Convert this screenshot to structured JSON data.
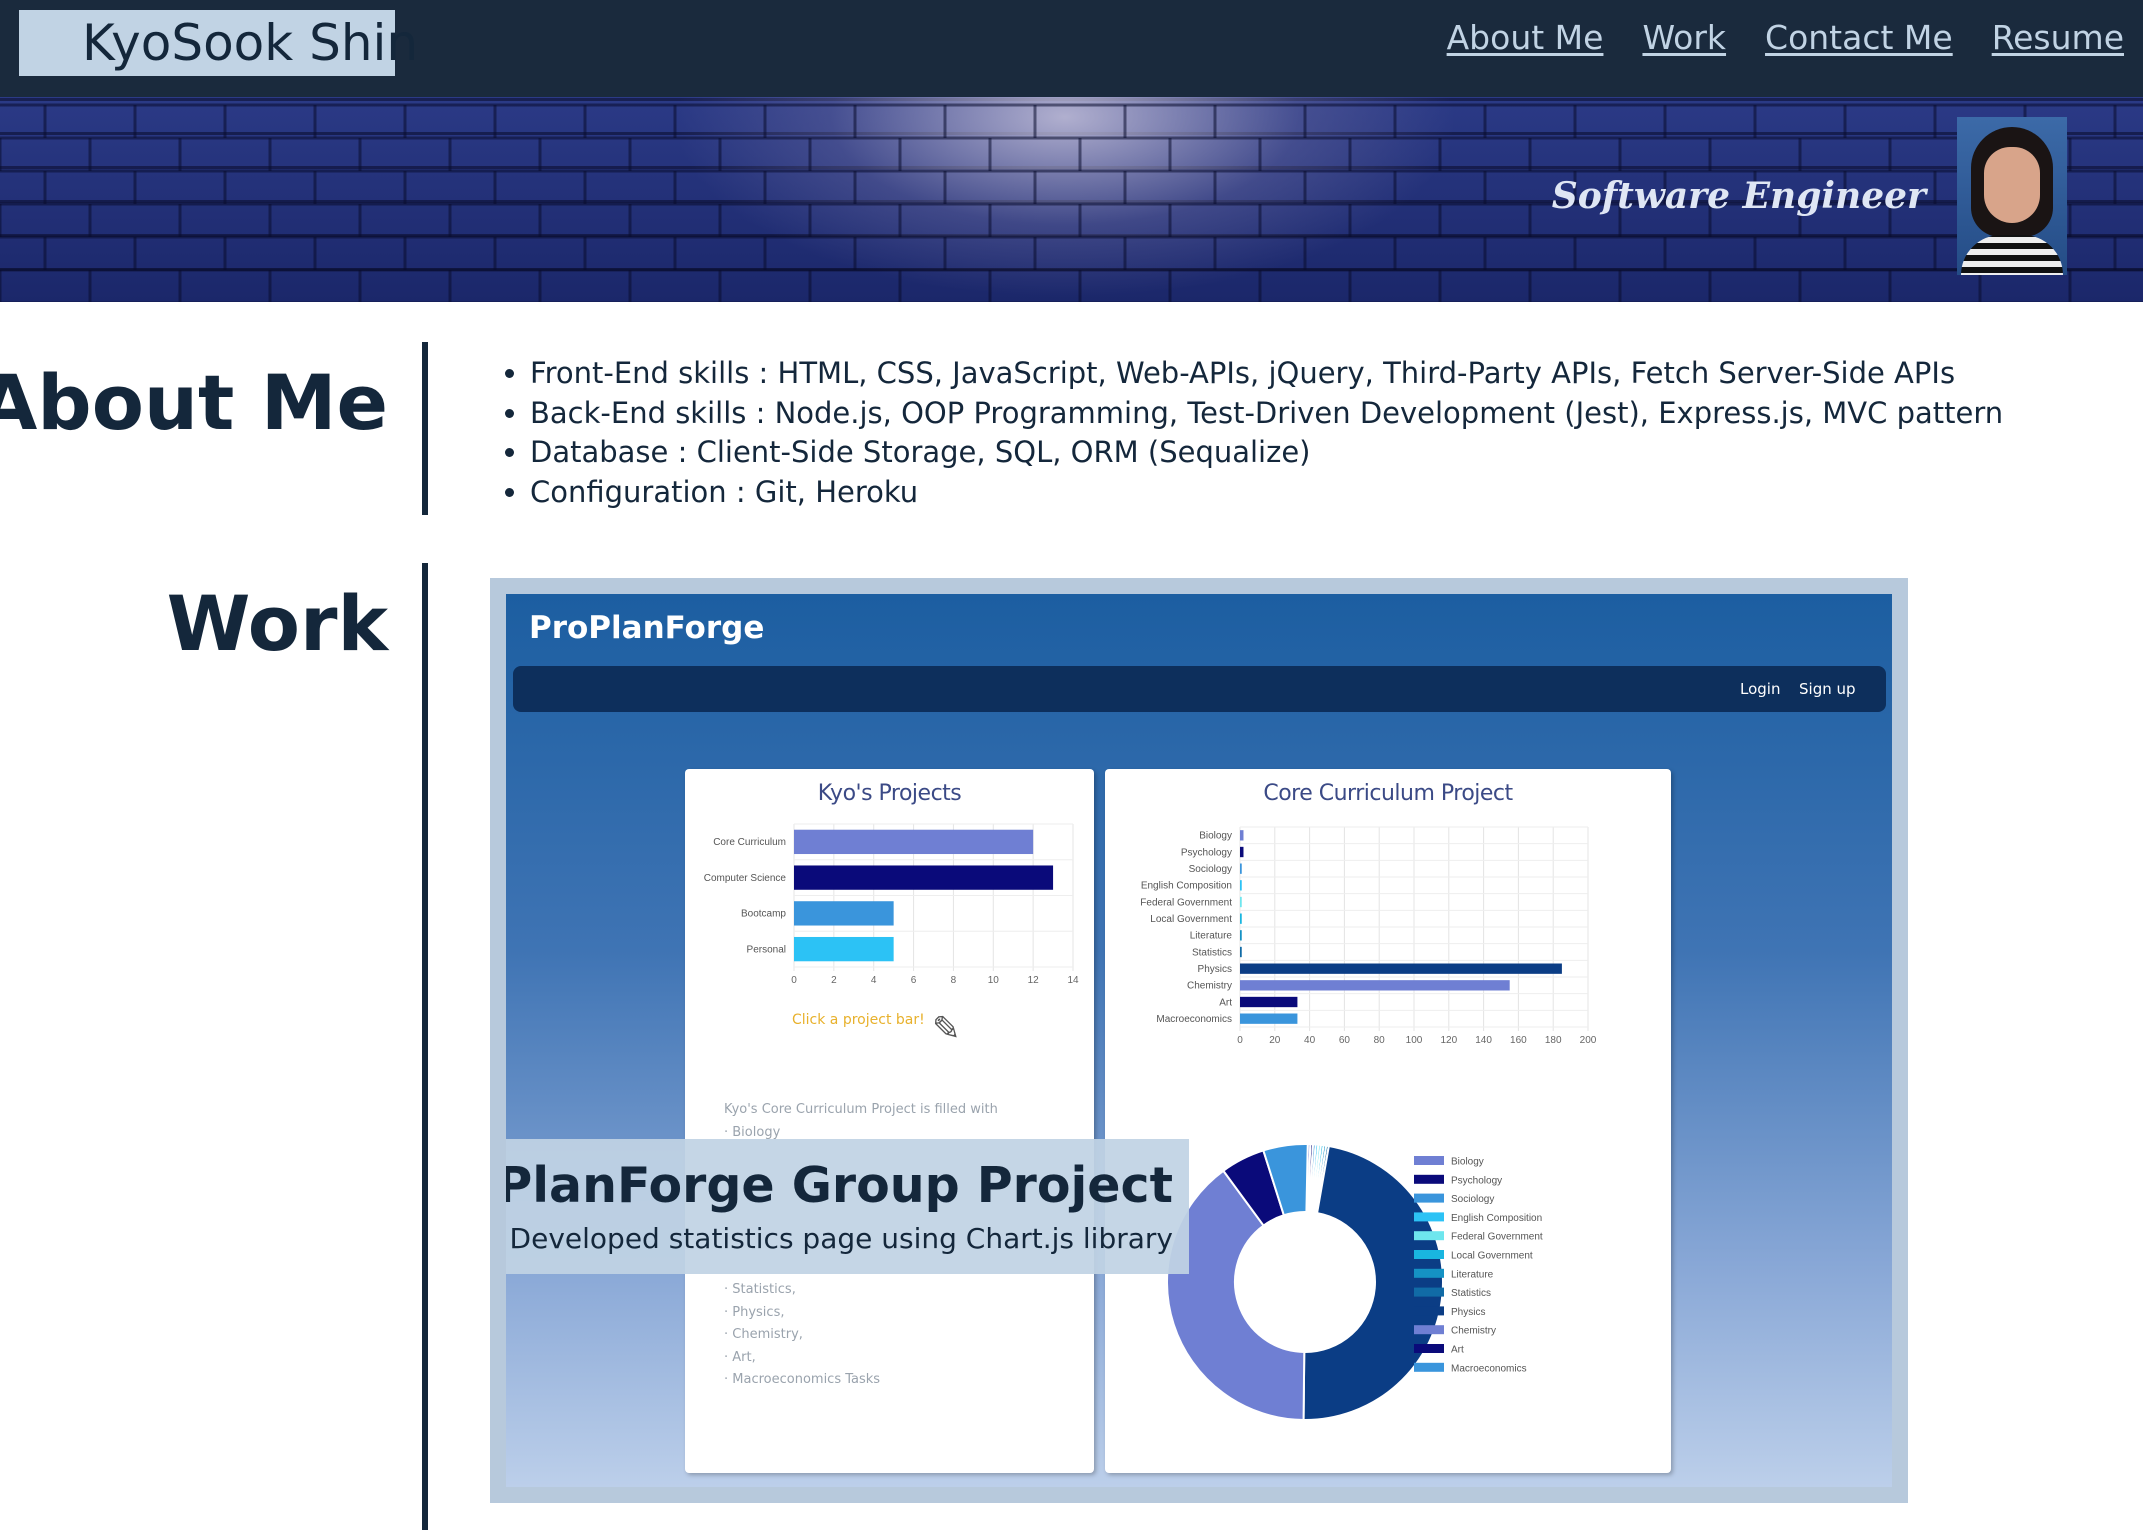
{
  "header": {
    "brand": "KyoSook Shin",
    "nav": [
      "About Me",
      "Work",
      "Contact Me",
      "Resume"
    ]
  },
  "hero": {
    "tagline": "Software Engineer"
  },
  "about": {
    "title": "About Me",
    "skills": [
      "Front-End skills : HTML, CSS, JavaScript, Web-APIs, jQuery, Third-Party APIs, Fetch Server-Side APIs",
      "Back-End skills : Node.js, OOP Programming, Test-Driven Development (Jest), Express.js, MVC pattern",
      "Database : Client-Side Storage, SQL, ORM (Sequalize)",
      "Configuration : Git, Heroku"
    ]
  },
  "work": {
    "title": "Work",
    "project_title": "ProPlanForge Group Project",
    "project_subtitle": "Developed statistics page using Chart.js library",
    "screenshot": {
      "app_name": "ProPlanForge",
      "nav": [
        "Login",
        "Sign up"
      ],
      "hint": "Click a project bar!",
      "list_heading": "Kyo's Core Curriculum Project is filled with",
      "list_items": [
        "· Biology",
        "· Statistics,",
        "· Physics,",
        "· Chemistry,",
        "· Art,",
        "· Macroeconomics Tasks"
      ]
    }
  },
  "colors": {
    "navy": "#1a2a3d",
    "accent_light": "#c1d3e4",
    "text_dark": "#14273b"
  },
  "chart_data": [
    {
      "type": "bar",
      "orientation": "horizontal",
      "title": "Kyo's Projects",
      "categories": [
        "Core Curriculum",
        "Computer Science",
        "Bootcamp",
        "Personal"
      ],
      "values": [
        12,
        13,
        5,
        5
      ],
      "colors": [
        "#6f7fd3",
        "#0a0a7a",
        "#3a95dc",
        "#2cc2f5"
      ],
      "xticks": [
        "0",
        "2",
        "4",
        "6",
        "8",
        "10",
        "12",
        "14"
      ],
      "xlim": [
        0,
        14
      ]
    },
    {
      "type": "bar",
      "orientation": "horizontal",
      "title": "Core Curriculum Project",
      "categories": [
        "Biology",
        "Psychology",
        "Sociology",
        "English Composition",
        "Federal Government",
        "Local Government",
        "Literature",
        "Statistics",
        "Physics",
        "Chemistry",
        "Art",
        "Macroeconomics"
      ],
      "values": [
        2,
        2,
        1,
        1,
        1,
        1,
        1,
        1,
        185,
        155,
        33,
        33
      ],
      "colors": [
        "#6f7fd3",
        "#0a0a7a",
        "#3a95dc",
        "#2cc2f5",
        "#6ee6ee",
        "#19b6e0",
        "#1592c4",
        "#116ba6",
        "#0b3d85",
        "#6f7fd3",
        "#0a0a7a",
        "#3a95dc"
      ],
      "xticks": [
        "0",
        "20",
        "40",
        "60",
        "80",
        "100",
        "120",
        "140",
        "160",
        "180",
        "200"
      ],
      "xlim": [
        0,
        200
      ]
    },
    {
      "type": "pie",
      "style": "doughnut",
      "labels": [
        "Biology",
        "Psychology",
        "Sociology",
        "English Composition",
        "Federal Government",
        "Local Government",
        "Literature",
        "Statistics",
        "Physics",
        "Chemistry",
        "Art",
        "Macroeconomics"
      ],
      "values": [
        1,
        1,
        1,
        1,
        1,
        1,
        1,
        1,
        155,
        130,
        17,
        17
      ],
      "colors": [
        "#6f7fd3",
        "#0a0a7a",
        "#3a95dc",
        "#2cc2f5",
        "#6ee6ee",
        "#19b6e0",
        "#1592c4",
        "#116ba6",
        "#0b3d85",
        "#6f7fd3",
        "#0a0a7a",
        "#3a95dc"
      ],
      "legend": "right"
    }
  ]
}
